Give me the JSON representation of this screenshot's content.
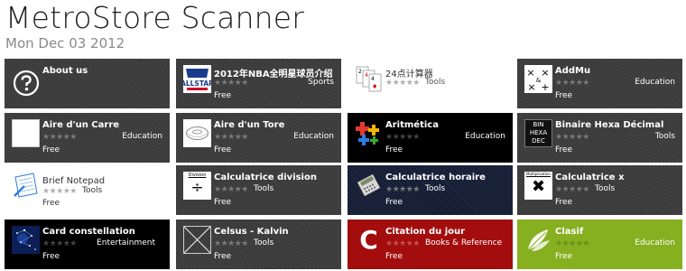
{
  "app": {
    "title": "MetroStore Scanner",
    "date": "Mon Dec 03 2012"
  },
  "tiles": [
    {
      "name": "About us",
      "stars": "",
      "category": "",
      "price": "",
      "icon": "question-circle-icon"
    },
    {
      "name": "2012年NBA全明星球员介绍",
      "stars": "★★★★★",
      "category": "Sports",
      "price": "Free",
      "icon": "nba-allstar-icon"
    },
    {
      "name": "24点计算器",
      "stars": "★★★★★",
      "category": "Tools",
      "price": "Free",
      "icon": "playing-cards-icon"
    },
    {
      "name": "AddMu",
      "stars": "★★★★★",
      "category": "Education",
      "price": "Free",
      "icon": "math-operators-icon"
    },
    {
      "name": "Aire d'un Carre",
      "stars": "★★★★★",
      "category": "Education",
      "price": "Free",
      "icon": "square-icon"
    },
    {
      "name": "Aire d'un Tore",
      "stars": "★★★★★",
      "category": "Education",
      "price": "Free",
      "icon": "torus-icon"
    },
    {
      "name": "Aritmética",
      "stars": "★★★★★",
      "category": "Education",
      "price": "Free",
      "icon": "plus-blocks-icon"
    },
    {
      "name": "Binaire Hexa Décimal",
      "stars": "★★★★★",
      "category": "Tools",
      "price": "Free",
      "icon": "bin-hexa-dec-icon",
      "icon_text": [
        "BIN",
        "HEXA",
        "DEC"
      ]
    },
    {
      "name": "Brief Notepad",
      "stars": "★★★★★",
      "category": "Tools",
      "price": "Free",
      "icon": "notepad-icon"
    },
    {
      "name": "Calculatrice division",
      "stars": "★★★★★",
      "category": "Tools",
      "price": "Free",
      "icon": "division-icon",
      "icon_text": [
        "Division",
        "÷"
      ]
    },
    {
      "name": "Calculatrice horaire",
      "stars": "★★★★★",
      "category": "Tools",
      "price": "Free",
      "icon": "calculator-icon"
    },
    {
      "name": "Calculatrice x",
      "stars": "★★★★★",
      "category": "Tools",
      "price": "Free",
      "icon": "multiply-icon",
      "icon_text": [
        "Multiplication",
        "✖"
      ]
    },
    {
      "name": "Card constellation",
      "stars": "★★★★★",
      "category": "Entertainment",
      "price": "Free",
      "icon": "constellation-icon"
    },
    {
      "name": "Celsus - Kalvin",
      "stars": "★★★★★",
      "category": "Tools",
      "price": "Free",
      "icon": "crossed-box-icon"
    },
    {
      "name": "Citation du jour",
      "stars": "★★★★★",
      "category": "Books & Reference",
      "price": "Free",
      "icon": "letter-c-icon",
      "icon_text": [
        "C"
      ]
    },
    {
      "name": "Clasif",
      "stars": "★★★★★",
      "category": "Education",
      "price": "Free",
      "icon": "leaves-icon"
    }
  ]
}
